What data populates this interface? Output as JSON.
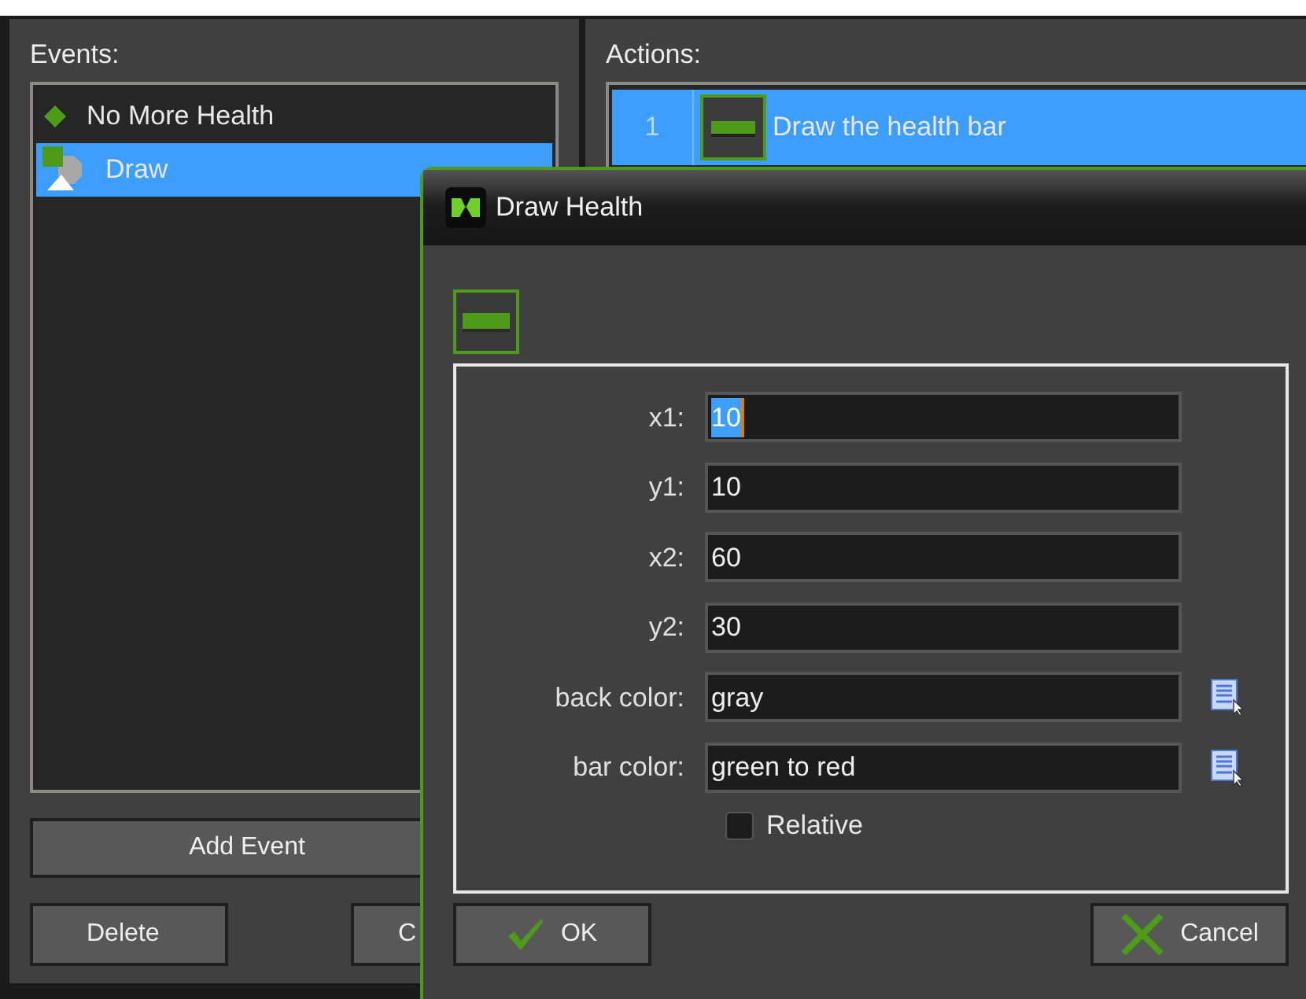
{
  "events_panel": {
    "label": "Events:",
    "events": [
      {
        "name": "No More Health",
        "kind": "diamond",
        "selected": false
      },
      {
        "name": "Draw",
        "kind": "draw",
        "selected": true
      }
    ],
    "buttons": [
      "Add Event"
    ],
    "bottom_buttons": [
      "Delete",
      "C"
    ]
  },
  "actions_panel": {
    "label": "Actions:",
    "actions": [
      {
        "number": "1",
        "name": "Draw the health bar",
        "selected": true
      }
    ]
  },
  "dialog": {
    "title": "Draw Health",
    "fields": [
      {
        "label": "x1:",
        "value": "10",
        "text_selected": true,
        "picker": false
      },
      {
        "label": "y1:",
        "value": "10",
        "text_selected": false,
        "picker": false
      },
      {
        "label": "x2:",
        "value": "60",
        "text_selected": false,
        "picker": false
      },
      {
        "label": "y2:",
        "value": "30",
        "text_selected": false,
        "picker": false
      },
      {
        "label": "back color:",
        "value": "gray",
        "text_selected": false,
        "picker": true
      },
      {
        "label": "bar color:",
        "value": "green to red",
        "text_selected": false,
        "picker": true
      }
    ],
    "relative": {
      "label": "Relative",
      "checked": false
    },
    "ok": "OK",
    "cancel": "Cancel"
  }
}
